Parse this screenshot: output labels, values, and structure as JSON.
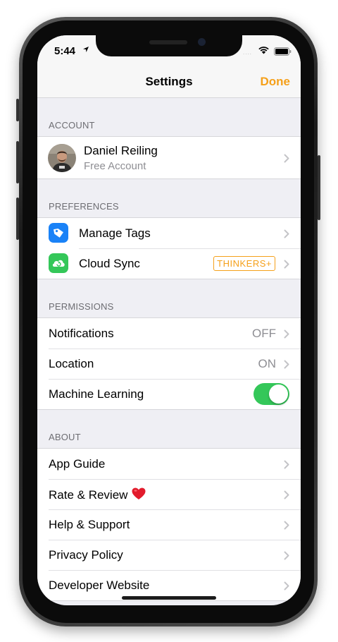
{
  "status_bar": {
    "time": "5:44",
    "signal": "....",
    "icons": [
      "location-arrow-icon",
      "wifi-icon",
      "battery-icon"
    ]
  },
  "nav": {
    "title": "Settings",
    "done": "Done"
  },
  "colors": {
    "accent": "#f5a01a",
    "toggle_on": "#34c759",
    "tag_icon": "#1a82f7",
    "cloud_icon": "#34c759"
  },
  "account": {
    "header": "ACCOUNT",
    "name": "Daniel Reiling",
    "plan": "Free Account"
  },
  "preferences": {
    "header": "PREFERENCES",
    "manage_tags": "Manage Tags",
    "cloud_sync": "Cloud Sync",
    "cloud_badge": "THINKERS+"
  },
  "permissions": {
    "header": "PERMISSIONS",
    "notifications": {
      "label": "Notifications",
      "value": "OFF"
    },
    "location": {
      "label": "Location",
      "value": "ON"
    },
    "machine_learning": {
      "label": "Machine Learning",
      "enabled": true
    }
  },
  "about": {
    "header": "ABOUT",
    "app_guide": "App Guide",
    "rate_review": "Rate & Review",
    "help_support": "Help & Support",
    "privacy_policy": "Privacy Policy",
    "developer_website": "Developer Website"
  }
}
